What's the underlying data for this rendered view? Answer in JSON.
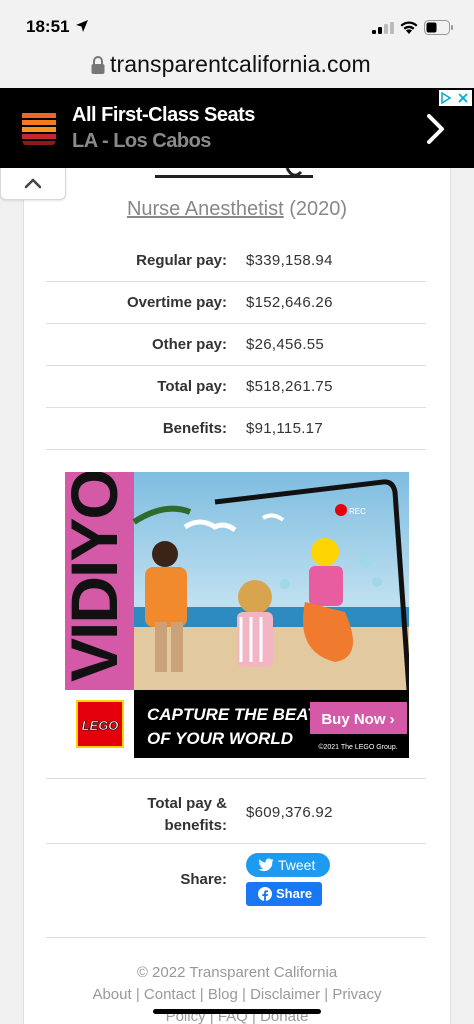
{
  "status_bar": {
    "time": "18:51"
  },
  "browser": {
    "url": "transparentcalifornia.com"
  },
  "top_ad": {
    "title": "All First-Class Seats",
    "subtitle": "LA - Los Cabos"
  },
  "record": {
    "job_title": "Nurse Anesthetist",
    "year": "(2020)",
    "rows": [
      {
        "label": "Regular pay:",
        "value": "$339,158.94"
      },
      {
        "label": "Overtime pay:",
        "value": "$152,646.26"
      },
      {
        "label": "Other pay:",
        "value": "$26,456.55"
      },
      {
        "label": "Total pay:",
        "value": "$518,261.75"
      },
      {
        "label": "Benefits:",
        "value": "$91,115.17"
      }
    ],
    "total_label_line1": "Total pay &",
    "total_label_line2": "benefits:",
    "total_value": "$609,376.92"
  },
  "lego_ad": {
    "brand": "VIDIYO",
    "logo_text": "LEGO",
    "tagline_line1": "CAPTURE THE BEAT",
    "tagline_line2": "OF YOUR WORLD",
    "cta": "Buy Now ›",
    "copyright": "©2021 The LEGO Group.",
    "rec_label": "REC"
  },
  "share": {
    "label": "Share:",
    "tweet_label": "Tweet",
    "facebook_label": "Share"
  },
  "footer": {
    "copyright": "© 2022 Transparent California",
    "links": [
      "About",
      "Contact",
      "Blog",
      "Disclaimer",
      "Privacy",
      "Policy",
      "FAQ",
      "Donate"
    ]
  },
  "colors": {
    "twitter": "#1d9bf0",
    "facebook": "#1877f2",
    "lego_pink": "#d45aa7",
    "lego_red": "#e3000b",
    "lego_yellow": "#ffd500"
  }
}
